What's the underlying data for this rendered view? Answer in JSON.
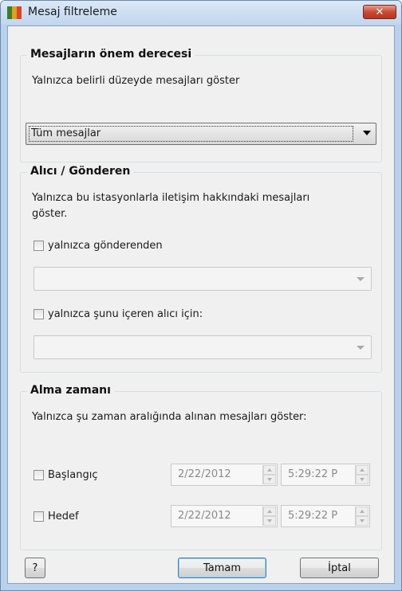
{
  "window": {
    "title": "Mesaj filtreleme",
    "close_label": "✕",
    "icon": "avg-logo-icon"
  },
  "importance": {
    "title": "Mesajların önem derecesi",
    "description": "Yalnızca belirli düzeyde mesajları göster",
    "selected": "Tüm mesajlar"
  },
  "recipient": {
    "title": "Alıcı / Gönderen",
    "description_line1": "Yalnızca bu istasyonlarla iletişim hakkındaki mesajları",
    "description_line2": "göster.",
    "from_label": "yalnızca gönderenden",
    "from_value": "",
    "to_label": "yalnızca şunu içeren alıcı için:",
    "to_value": ""
  },
  "time": {
    "title": "Alma zamanı",
    "description": "Yalnızca şu zaman aralığında alınan mesajları göster:",
    "start_label": "Başlangıç",
    "start_date": "2/22/2012",
    "start_time": "5:29:22 P",
    "end_label": "Hedef",
    "end_date": "2/22/2012",
    "end_time": "5:29:22 P"
  },
  "buttons": {
    "help": "?",
    "ok": "Tamam",
    "cancel": "İptal"
  },
  "colors": {
    "titlebar": "#c2d6ee",
    "close": "#c94a33",
    "client_bg": "#f0f0f0"
  }
}
